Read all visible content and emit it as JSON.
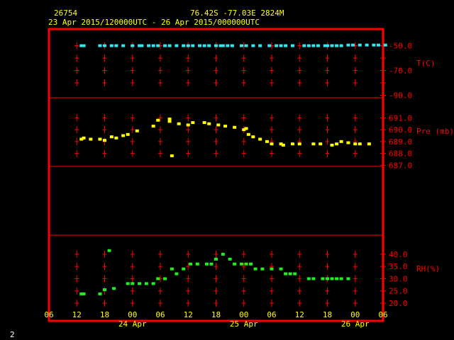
{
  "header": {
    "station": "26754",
    "location": "76.42S   -77.03E   2824M",
    "time_range": "23 Apr 2015/120000UTC - 26 Apr 2015/000000UTC"
  },
  "footer": {
    "page_number": "2"
  },
  "colors": {
    "frame": "#ff0000",
    "temperature": "#33e6f0",
    "pressure": "#ffff00",
    "humidity": "#22ee22",
    "text": "#ffff00"
  },
  "chart_data": {
    "type": "scatter",
    "x_axis": {
      "unit": "hour offset from 23 Apr 06 UTC",
      "range": [
        0,
        72
      ],
      "tick_step": 6,
      "tick_labels": [
        "06",
        "12",
        "18",
        "00",
        "06",
        "12",
        "18",
        "00",
        "06",
        "12",
        "18",
        "00",
        "06"
      ],
      "date_labels": [
        {
          "label": "24 Apr",
          "at_tick": "00"
        },
        {
          "label": "25 Apr",
          "at_tick": "00"
        },
        {
          "label": "26 Apr",
          "at_tick": "00"
        }
      ]
    },
    "panels": [
      {
        "name": "temperature",
        "ylabel": "T(C)",
        "ylim": [
          -92,
          -48
        ],
        "tick_labels": [
          "-50.0",
          "-70.0",
          "-90.0"
        ],
        "tick_values": [
          -50,
          -60,
          -70,
          -80,
          -90
        ],
        "x": [
          7,
          7.5,
          11,
          12,
          13.5,
          14.5,
          16,
          18,
          19.5,
          20,
          21.5,
          22.5,
          23.5,
          25,
          26,
          27.5,
          29,
          30,
          31,
          32.5,
          33.5,
          34.5,
          36,
          37,
          37.5,
          38.5,
          39.5,
          41.5,
          42.5,
          44,
          45.5,
          47.5,
          49,
          50,
          51,
          52.5,
          55,
          56,
          57,
          58,
          59.5,
          60,
          61,
          62,
          63,
          64.5,
          65.5,
          67,
          68.5,
          70,
          71,
          72.5
        ],
        "values": [
          -50,
          -50,
          -50,
          -50,
          -50,
          -50,
          -50,
          -50,
          -50,
          -50,
          -50,
          -50,
          -50,
          -50,
          -50,
          -50,
          -50,
          -50,
          -50,
          -50,
          -50,
          -50,
          -50,
          -50,
          -50,
          -50,
          -50,
          -50,
          -50,
          -50,
          -50,
          -50,
          -50,
          -50,
          -50,
          -50,
          -50,
          -50,
          -50,
          -50,
          -50,
          -50,
          -50,
          -50,
          -50,
          -49.5,
          -49.5,
          -49.5,
          -49.5,
          -49.5,
          -49.5,
          -49.5
        ]
      },
      {
        "name": "pressure",
        "ylabel": "Pre (mb)",
        "ylim": [
          686.9,
          691.5
        ],
        "tick_labels": [
          "691.0",
          "690.0",
          "689.0",
          "688.0",
          "687.0"
        ],
        "tick_values": [
          691,
          690,
          689,
          688,
          687
        ],
        "x": [
          7,
          7.5,
          9,
          11,
          12,
          13.5,
          14.5,
          16,
          17,
          19,
          22.5,
          23.5,
          26,
          26.5,
          26,
          28,
          30,
          31,
          33.5,
          34.5,
          36.5,
          38,
          40,
          42,
          42.5,
          43,
          44,
          45.5,
          47,
          48,
          50,
          50.5,
          52.5,
          54,
          57,
          58.5,
          61,
          62,
          63,
          64.5,
          66,
          67,
          69
        ],
        "values": [
          689.2,
          689.3,
          689.2,
          689.2,
          689.1,
          689.4,
          689.3,
          689.5,
          689.6,
          689.9,
          690.3,
          690.8,
          690.9,
          687.8,
          690.7,
          690.5,
          690.4,
          690.6,
          690.6,
          690.5,
          690.4,
          690.3,
          690.2,
          690.0,
          690.1,
          689.6,
          689.4,
          689.2,
          689.0,
          688.8,
          688.8,
          688.7,
          688.8,
          688.8,
          688.8,
          688.8,
          688.7,
          688.8,
          689.0,
          688.9,
          688.8,
          688.8,
          688.8
        ]
      },
      {
        "name": "humidity",
        "ylabel": "RH(%)",
        "ylim": [
          20,
          42
        ],
        "tick_labels": [
          "40.0",
          "35.0",
          "30.0",
          "25.0",
          "20.0"
        ],
        "tick_values": [
          40,
          35,
          30,
          25,
          20
        ],
        "x": [
          7,
          7.5,
          11,
          12,
          13,
          14,
          17,
          18,
          19.5,
          21,
          22.5,
          23.5,
          25,
          26.5,
          27.5,
          29,
          30.5,
          32,
          34,
          35,
          36,
          37.5,
          39,
          40,
          41.5,
          42.5,
          43.5,
          44.5,
          46,
          48,
          50,
          51,
          52,
          53,
          56,
          57,
          59,
          60,
          61,
          62,
          63,
          64.5
        ],
        "values": [
          23.8,
          23.8,
          23.8,
          25.5,
          41.5,
          26,
          28,
          28,
          28,
          28,
          28,
          30,
          30,
          34,
          32,
          34,
          36,
          36,
          36,
          36,
          38,
          40,
          38,
          36,
          36,
          36,
          36,
          34,
          34,
          34,
          34,
          32,
          32,
          32,
          30,
          30,
          30,
          30,
          30,
          30,
          30,
          30
        ]
      }
    ]
  }
}
